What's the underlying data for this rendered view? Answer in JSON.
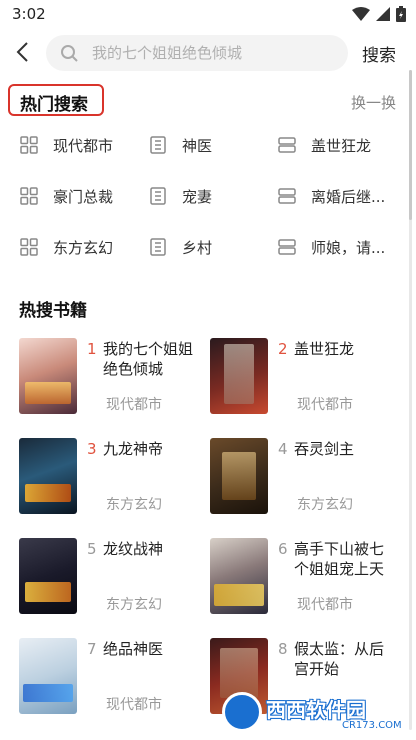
{
  "status_bar": {
    "time": "3:02"
  },
  "search": {
    "placeholder": "我的七个姐姐绝色倾城",
    "button_label": "搜索"
  },
  "hot_search": {
    "title": "热门搜索",
    "refresh_label": "换一换",
    "rows": [
      [
        {
          "label": "现代都市",
          "icon": "grid-icon"
        },
        {
          "label": "神医",
          "icon": "book-icon"
        },
        {
          "label": "盖世狂龙",
          "icon": "list-icon"
        }
      ],
      [
        {
          "label": "豪门总裁",
          "icon": "grid-icon"
        },
        {
          "label": "宠妻",
          "icon": "book-icon"
        },
        {
          "label": "离婚后继...",
          "icon": "list-icon"
        }
      ],
      [
        {
          "label": "东方玄幻",
          "icon": "grid-icon"
        },
        {
          "label": "乡村",
          "icon": "book-icon"
        },
        {
          "label": "师娘，请...",
          "icon": "list-icon"
        }
      ]
    ]
  },
  "hot_books": {
    "title": "热搜书籍",
    "items": [
      {
        "rank": "1",
        "name": "我的七个姐姐绝色倾城",
        "category": "现代都市"
      },
      {
        "rank": "2",
        "name": "盖世狂龙",
        "category": "现代都市"
      },
      {
        "rank": "3",
        "name": "九龙神帝",
        "category": "东方玄幻"
      },
      {
        "rank": "4",
        "name": "吞灵剑主",
        "category": "东方玄幻"
      },
      {
        "rank": "5",
        "name": "龙纹战神",
        "category": "东方玄幻"
      },
      {
        "rank": "6",
        "name": "高手下山被七个姐姐宠上天",
        "category": "现代都市"
      },
      {
        "rank": "7",
        "name": "绝品神医",
        "category": "现代都市"
      },
      {
        "rank": "8",
        "name": "假太监：从后宫开始",
        "category": "现代都市"
      }
    ]
  },
  "watermark": {
    "brand": "西西软件园",
    "url": "CR173.COM"
  },
  "colors": {
    "accent_red": "#d9342b",
    "rank_red": "#e0533f",
    "muted": "#999999"
  }
}
